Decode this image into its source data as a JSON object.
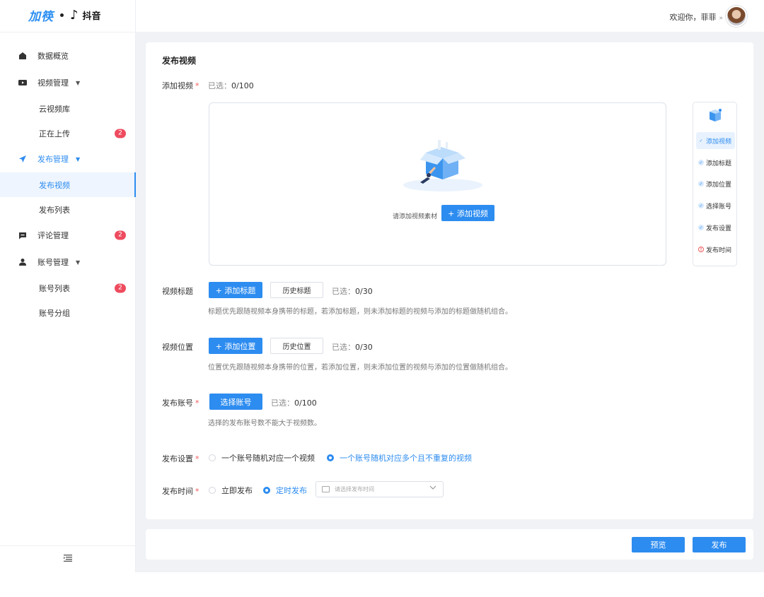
{
  "brand": {
    "logo_text": "加筷",
    "platform_text": "抖音",
    "colors": {
      "primary": "#2d8cf0",
      "badge": "#ee4b5e",
      "required": "#f05a5a"
    }
  },
  "header": {
    "welcome": "欢迎你，菲菲",
    "welcome_chevron": "»"
  },
  "sidebar": {
    "items": [
      {
        "label": "数据概览",
        "icon": "home-icon"
      },
      {
        "label": "视频管理",
        "icon": "video-camera-icon",
        "caret": "▼",
        "children": [
          {
            "label": "云视频库"
          },
          {
            "label": "正在上传",
            "badge": "2"
          }
        ]
      },
      {
        "label": "发布管理",
        "icon": "paper-plane-icon",
        "caret": "▼",
        "children": [
          {
            "label": "发布视频"
          },
          {
            "label": "发布列表"
          }
        ]
      },
      {
        "label": "评论管理",
        "icon": "comment-icon",
        "badge": "2"
      },
      {
        "label": "账号管理",
        "icon": "user-group-icon",
        "caret": "▼",
        "children": [
          {
            "label": "账号列表",
            "badge": "2"
          },
          {
            "label": "账号分组"
          }
        ]
      }
    ],
    "collapse_icon": "menu-collapse-icon"
  },
  "main": {
    "title": "发布视频",
    "add_video": {
      "label": "添加视频",
      "required_mark": "*",
      "selected_prefix": "已选：",
      "selected_value": "0/100",
      "upload_hint": "请添加视频素材",
      "add_button": "+ 添加视频"
    },
    "video_title": {
      "label": "视频标题",
      "add_button": "+ 添加标题",
      "history_button": "历史标题",
      "selected_prefix": "已选：",
      "selected_value": "0/30",
      "hint": "标题优先跟随视频本身携带的标题，若添加标题，则未添加标题的视频与添加的标题做随机组合。"
    },
    "video_location": {
      "label": "视频位置",
      "add_button": "+ 添加位置",
      "history_button": "历史位置",
      "selected_prefix": "已选：",
      "selected_value": "0/30",
      "hint": "位置优先跟随视频本身携带的位置，若添加位置，则未添加位置的视频与添加的位置做随机组合。"
    },
    "publish_account": {
      "label": "发布账号",
      "required_mark": "*",
      "select_button": "选择账号",
      "selected_prefix": "已选：",
      "selected_value": "0/100",
      "hint": "选择的发布账号数不能大于视频数。"
    },
    "publish_settings": {
      "label": "发布设置",
      "required_mark": "*",
      "options": [
        "一个账号随机对应一个视频",
        "一个账号随机对应多个且不重复的视频"
      ],
      "selected": "一个账号随机对应多个且不重复的视频"
    },
    "publish_time": {
      "label": "发布时间",
      "required_mark": "*",
      "options": [
        "立即发布",
        "定时发布"
      ],
      "selected": "定时发布",
      "picker_placeholder": "请选择发布时间"
    }
  },
  "steps": [
    {
      "label": "添加视频",
      "state": "active"
    },
    {
      "label": "添加标题",
      "state": "done"
    },
    {
      "label": "添加位置",
      "state": "done"
    },
    {
      "label": "选择账号",
      "state": "done"
    },
    {
      "label": "发布设置",
      "state": "done"
    },
    {
      "label": "发布时间",
      "state": "warning"
    }
  ],
  "footer": {
    "preview_button": "预览",
    "publish_button": "发布"
  }
}
